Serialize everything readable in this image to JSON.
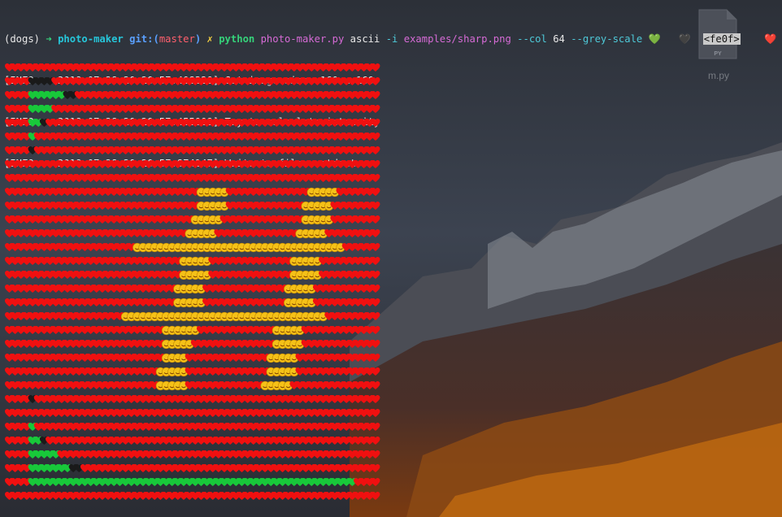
{
  "terminal": {
    "prompt": {
      "env": "(dogs)",
      "arrow": "➜",
      "dir": "photo-maker",
      "git_prefix": "git:(",
      "branch": "master",
      "git_suffix": ")",
      "dirty": "✗"
    },
    "command": {
      "program": "python",
      "script": "photo-maker.py",
      "subcommand": "ascii",
      "flag_input": "-i",
      "input_file": "examples/sharp.png",
      "flag_col": "--col",
      "col_value": "64",
      "flag_grey": "--grey-scale",
      "tail_glyph_1": "💚",
      "tail_glyph_2": "🖤",
      "tail_tag": "<fe0f>",
      "tail_glyph_3": "❤️",
      "tail_glyph_4": "😊"
    },
    "logs": [
      {
        "level": "[INFO",
        "timestamp": "2018-07-28 20:20:57.408320]",
        "message": "Got image size: 160 x 160"
      },
      {
        "level": "[INFO",
        "timestamp": "2018-07-28 20:20:57.455009]",
        "message": "Try to calculate intensity"
      },
      {
        "level": "[INFO",
        "timestamp": "2018-07-28 20:20:57.874147]",
        "message": "Write to file: <stdout>"
      }
    ]
  },
  "art": {
    "columns": 64,
    "legend": {
      "R": "red-heart",
      "G": "green-heart",
      "K": "black-heart",
      "Y": "smiling-face"
    },
    "rows": [
      "RRRRRRRRRRRRRRRRRRRRRRRRRRRRRRRRRRRRRRRRRRRRRRRRRRRRRRRRRRRRRRRR",
      "RRRRKKKKRRRRRRRRRRRRRRRRRRRRRRRRRRRRRRRRRRRRRRRRRRRRRRRRRRRRRRRR",
      "RRRRGGGGGGKKRRRRRRRRRRRRRRRRRRRRRRRRRRRRRRRRRRRRRRRRRRRRRRRRRRRR",
      "RRRRGGGGRRRRRRRRRRRRRRRRRRRRRRRRRRRRRRRRRRRRRRRRRRRRRRRRRRRRRRRR",
      "RRRRGGKRRRRRRRRRRRRRRRRRRRRRRRRRRRRRRRRRRRRRRRRRRRRRRRRRRRRRRRRR",
      "RRRRGRRRRRRRRRRRRRRRRRRRRRRRRRRRRRRRRRRRRRRRRRRRRRRRRRRRRRRRRRRR",
      "RRRRKRRRRRRRRRRRRRRRRRRRRRRRRRRRRRRRRRRRRRRRRRRRRRRRRRRRRRRRRRRR",
      "RRRRRRRRRRRRRRRRRRRRRRRRRRRRRRRRRRRRRRRRRRRRRRRRRRRRRRRRRRRRRRRR",
      "RRRRRRRRRRRRRRRRRRRRRRRRRRRRRRRRRRRRRRRRRRRRRRRRRRRRRRRRRRRRRRRR",
      "RRRRRRRRRRRRRRRRRRRRRRRRRRRRRRRRRYYYYYRRRRRRRRRRRRRRYYYYYRRRRRRR",
      "RRRRRRRRRRRRRRRRRRRRRRRRRRRRRRRRRYYYYYRRRRRRRRRRRRRYYYYYRRRRRRRR",
      "RRRRRRRRRRRRRRRRRRRRRRRRRRRRRRRRYYYYYRRRRRRRRRRRRRRYYYYYRRRRRRRR",
      "RRRRRRRRRRRRRRRRRRRRRRRRRRRRRRRYYYYYRRRRRRRRRRRRRRYYYYYRRRRRRRRR",
      "RRRRRRRRRRRRRRRRRRRRRRYYYYYYYYYYYYYYYYYYYYYYYYYYYYYYYYYYYYRRRRRR",
      "RRRRRRRRRRRRRRRRRRRRRRRRRRRRRRYYYYYRRRRRRRRRRRRRRYYYYYRRRRRRRRRR",
      "RRRRRRRRRRRRRRRRRRRRRRRRRRRRRRYYYYYRRRRRRRRRRRRRRYYYYYRRRRRRRRRR",
      "RRRRRRRRRRRRRRRRRRRRRRRRRRRRRYYYYYRRRRRRRRRRRRRRYYYYYRRRRRRRRRRR",
      "RRRRRRRRRRRRRRRRRRRRRRRRRRRRRYYYYYRRRRRRRRRRRRRRYYYYYRRRRRRRRRRR",
      "RRRRRRRRRRRRRRRRRRRRYYYYYYYYYYYYYYYYYYYYYYYYYYYYYYYYYYYRRRRRRRRR",
      "RRRRRRRRRRRRRRRRRRRRRRRRRRRYYYYYYRRRRRRRRRRRRRYYYYYRRRRRRRRRRRRR",
      "RRRRRRRRRRRRRRRRRRRRRRRRRRRYYYYYRRRRRRRRRRRRRRYYYYYRRRRRRRRRRRRR",
      "RRRRRRRRRRRRRRRRRRRRRRRRRRRYYYYRRRRRRRRRRRRRRYYYYYRRRRRRRRRRRRRR",
      "RRRRRRRRRRRRRRRRRRRRRRRRRRYYYYYRRRRRRRRRRRRRRYYYYYRRRRRRRRRRRRRR",
      "RRRRRRRRRRRRRRRRRRRRRRRRRRYYYYYRRRRRRRRRRRRRYYYYYRRRRRRRRRRRRRRR",
      "RRRRKRRRRRRRRRRRRRRRRRRRRRRRRRRRRRRRRRRRRRRRRRRRRRRRRRRRRRRRRRRR",
      "RRRRRRRRRRRRRRRRRRRRRRRRRRRRRRRRRRRRRRRRRRRRRRRRRRRRRRRRRRRRRRRR",
      "RRRRGRRRRRRRRRRRRRRRRRRRRRRRRRRRRRRRRRRRRRRRRRRRRRRRRRRRRRRRRRRR",
      "RRRRGGKRRRRRRRRRRRRRRRRRRRRRRRRRRRRRRRRRRRRRRRRRRRRRRRRRRRRRRRRR",
      "RRRRGGGGGRRRRRRRRRRRRRRRRRRRRRRRRRRRRRRRRRRRRRRRRRRRRRRRRRRRRRRR",
      "RRRRGGGGGGGKKRRRRRRRRRRRRRRRRRRRRRRRRRRRRRRRRRRRRRRRRRRRRRRRRRRR",
      "RRRRGGGGGGGGGGGGGGGGGGGGGGGGGGGGGGGGGGGGGGGGGGGGGGGGGGGGGGGGRRRR",
      "RRRRRRRRRRRRRRRRRRRRRRRRRRRRRRRRRRRRRRRRRRRRRRRRRRRRRRRRRRRRRRRR"
    ]
  },
  "desktop": {
    "file_icon_badge": "PY",
    "file_icon_label": "m.py"
  },
  "colors": {
    "red_heart": "#f01010",
    "green_heart": "#18c83a",
    "black_heart": "#1a1a1a",
    "smile_face": "#f5c118"
  }
}
